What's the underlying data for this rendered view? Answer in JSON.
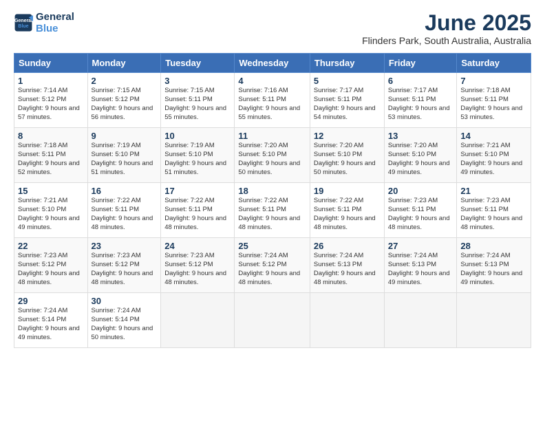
{
  "logo": {
    "line1": "General",
    "line2": "Blue"
  },
  "title": "June 2025",
  "subtitle": "Flinders Park, South Australia, Australia",
  "weekdays": [
    "Sunday",
    "Monday",
    "Tuesday",
    "Wednesday",
    "Thursday",
    "Friday",
    "Saturday"
  ],
  "weeks": [
    [
      {
        "num": "1",
        "sunrise": "Sunrise: 7:14 AM",
        "sunset": "Sunset: 5:12 PM",
        "daylight": "Daylight: 9 hours and 57 minutes."
      },
      {
        "num": "2",
        "sunrise": "Sunrise: 7:15 AM",
        "sunset": "Sunset: 5:12 PM",
        "daylight": "Daylight: 9 hours and 56 minutes."
      },
      {
        "num": "3",
        "sunrise": "Sunrise: 7:15 AM",
        "sunset": "Sunset: 5:11 PM",
        "daylight": "Daylight: 9 hours and 55 minutes."
      },
      {
        "num": "4",
        "sunrise": "Sunrise: 7:16 AM",
        "sunset": "Sunset: 5:11 PM",
        "daylight": "Daylight: 9 hours and 55 minutes."
      },
      {
        "num": "5",
        "sunrise": "Sunrise: 7:17 AM",
        "sunset": "Sunset: 5:11 PM",
        "daylight": "Daylight: 9 hours and 54 minutes."
      },
      {
        "num": "6",
        "sunrise": "Sunrise: 7:17 AM",
        "sunset": "Sunset: 5:11 PM",
        "daylight": "Daylight: 9 hours and 53 minutes."
      },
      {
        "num": "7",
        "sunrise": "Sunrise: 7:18 AM",
        "sunset": "Sunset: 5:11 PM",
        "daylight": "Daylight: 9 hours and 53 minutes."
      }
    ],
    [
      {
        "num": "8",
        "sunrise": "Sunrise: 7:18 AM",
        "sunset": "Sunset: 5:11 PM",
        "daylight": "Daylight: 9 hours and 52 minutes."
      },
      {
        "num": "9",
        "sunrise": "Sunrise: 7:19 AM",
        "sunset": "Sunset: 5:10 PM",
        "daylight": "Daylight: 9 hours and 51 minutes."
      },
      {
        "num": "10",
        "sunrise": "Sunrise: 7:19 AM",
        "sunset": "Sunset: 5:10 PM",
        "daylight": "Daylight: 9 hours and 51 minutes."
      },
      {
        "num": "11",
        "sunrise": "Sunrise: 7:20 AM",
        "sunset": "Sunset: 5:10 PM",
        "daylight": "Daylight: 9 hours and 50 minutes."
      },
      {
        "num": "12",
        "sunrise": "Sunrise: 7:20 AM",
        "sunset": "Sunset: 5:10 PM",
        "daylight": "Daylight: 9 hours and 50 minutes."
      },
      {
        "num": "13",
        "sunrise": "Sunrise: 7:20 AM",
        "sunset": "Sunset: 5:10 PM",
        "daylight": "Daylight: 9 hours and 49 minutes."
      },
      {
        "num": "14",
        "sunrise": "Sunrise: 7:21 AM",
        "sunset": "Sunset: 5:10 PM",
        "daylight": "Daylight: 9 hours and 49 minutes."
      }
    ],
    [
      {
        "num": "15",
        "sunrise": "Sunrise: 7:21 AM",
        "sunset": "Sunset: 5:10 PM",
        "daylight": "Daylight: 9 hours and 49 minutes."
      },
      {
        "num": "16",
        "sunrise": "Sunrise: 7:22 AM",
        "sunset": "Sunset: 5:11 PM",
        "daylight": "Daylight: 9 hours and 48 minutes."
      },
      {
        "num": "17",
        "sunrise": "Sunrise: 7:22 AM",
        "sunset": "Sunset: 5:11 PM",
        "daylight": "Daylight: 9 hours and 48 minutes."
      },
      {
        "num": "18",
        "sunrise": "Sunrise: 7:22 AM",
        "sunset": "Sunset: 5:11 PM",
        "daylight": "Daylight: 9 hours and 48 minutes."
      },
      {
        "num": "19",
        "sunrise": "Sunrise: 7:22 AM",
        "sunset": "Sunset: 5:11 PM",
        "daylight": "Daylight: 9 hours and 48 minutes."
      },
      {
        "num": "20",
        "sunrise": "Sunrise: 7:23 AM",
        "sunset": "Sunset: 5:11 PM",
        "daylight": "Daylight: 9 hours and 48 minutes."
      },
      {
        "num": "21",
        "sunrise": "Sunrise: 7:23 AM",
        "sunset": "Sunset: 5:11 PM",
        "daylight": "Daylight: 9 hours and 48 minutes."
      }
    ],
    [
      {
        "num": "22",
        "sunrise": "Sunrise: 7:23 AM",
        "sunset": "Sunset: 5:12 PM",
        "daylight": "Daylight: 9 hours and 48 minutes."
      },
      {
        "num": "23",
        "sunrise": "Sunrise: 7:23 AM",
        "sunset": "Sunset: 5:12 PM",
        "daylight": "Daylight: 9 hours and 48 minutes."
      },
      {
        "num": "24",
        "sunrise": "Sunrise: 7:23 AM",
        "sunset": "Sunset: 5:12 PM",
        "daylight": "Daylight: 9 hours and 48 minutes."
      },
      {
        "num": "25",
        "sunrise": "Sunrise: 7:24 AM",
        "sunset": "Sunset: 5:12 PM",
        "daylight": "Daylight: 9 hours and 48 minutes."
      },
      {
        "num": "26",
        "sunrise": "Sunrise: 7:24 AM",
        "sunset": "Sunset: 5:13 PM",
        "daylight": "Daylight: 9 hours and 48 minutes."
      },
      {
        "num": "27",
        "sunrise": "Sunrise: 7:24 AM",
        "sunset": "Sunset: 5:13 PM",
        "daylight": "Daylight: 9 hours and 49 minutes."
      },
      {
        "num": "28",
        "sunrise": "Sunrise: 7:24 AM",
        "sunset": "Sunset: 5:13 PM",
        "daylight": "Daylight: 9 hours and 49 minutes."
      }
    ],
    [
      {
        "num": "29",
        "sunrise": "Sunrise: 7:24 AM",
        "sunset": "Sunset: 5:14 PM",
        "daylight": "Daylight: 9 hours and 49 minutes."
      },
      {
        "num": "30",
        "sunrise": "Sunrise: 7:24 AM",
        "sunset": "Sunset: 5:14 PM",
        "daylight": "Daylight: 9 hours and 50 minutes."
      },
      null,
      null,
      null,
      null,
      null
    ]
  ]
}
